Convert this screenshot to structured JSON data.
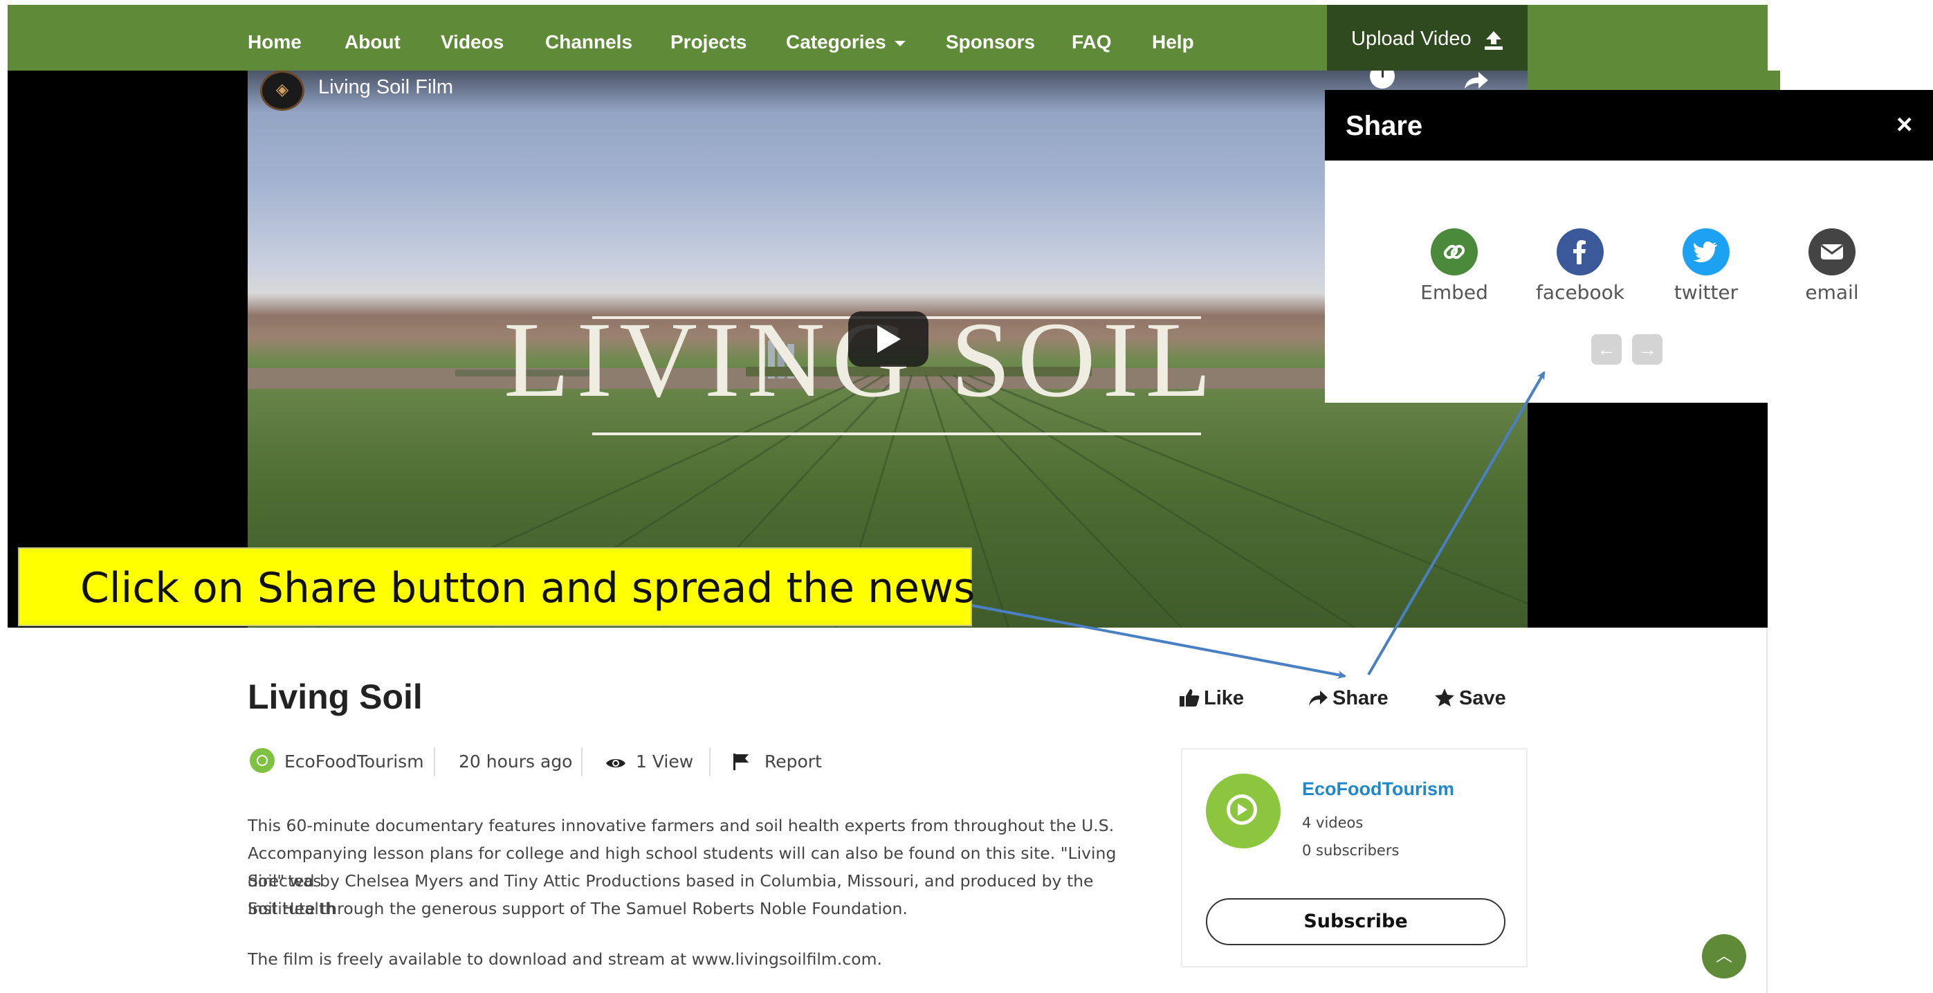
{
  "nav": {
    "items": [
      "Home",
      "About",
      "Videos",
      "Channels",
      "Projects",
      "Categories",
      "Sponsors",
      "FAQ",
      "Help"
    ],
    "upload_label": "Upload Video",
    "upload_icon": "upload-icon"
  },
  "video": {
    "channel_name": "Living Soil Film",
    "overlay_title": "LIVING SOIL",
    "play_icon": "play-icon"
  },
  "share": {
    "title": "Share",
    "close": "×",
    "options": [
      {
        "label": "Embed",
        "icon": "link-icon",
        "color": "#4a8a3a"
      },
      {
        "label": "facebook",
        "icon": "facebook-icon",
        "color": "#3b5998"
      },
      {
        "label": "twitter",
        "icon": "twitter-icon",
        "color": "#1da1f2"
      },
      {
        "label": "email",
        "icon": "envelope-icon",
        "color": "#444444"
      }
    ],
    "prev": "←",
    "next": "→"
  },
  "callout": {
    "text": "Click on Share button and spread the news"
  },
  "details": {
    "title": "Living Soil",
    "actions": {
      "like": "Like",
      "share": "Share",
      "save": "Save"
    },
    "author": "EcoFoodTourism",
    "posted": "20 hours ago",
    "views": "1 View",
    "report": "Report",
    "description": [
      "This 60-minute documentary features innovative farmers and soil health experts from throughout the U.S.",
      "Accompanying lesson plans for college and high school students will can also be found on this site. \"Living Soil\" was",
      "directed by Chelsea Myers and Tiny Attic Productions based in Columbia, Missouri, and produced by the Soil Health",
      "Institute through the generous support of The Samuel Roberts Noble Foundation."
    ],
    "availability": "The film is freely available to download and stream at www.livingsoilfilm.com."
  },
  "channel_card": {
    "name": "EcoFoodTourism",
    "videos": "4 videos",
    "subscribers": "0 subscribers",
    "subscribe_label": "Subscribe"
  },
  "colors": {
    "brand_green": "#5f8a38",
    "upload_bg": "#2f4a1f",
    "callout_yellow": "#ffff00",
    "link_blue": "#1e88c8"
  }
}
